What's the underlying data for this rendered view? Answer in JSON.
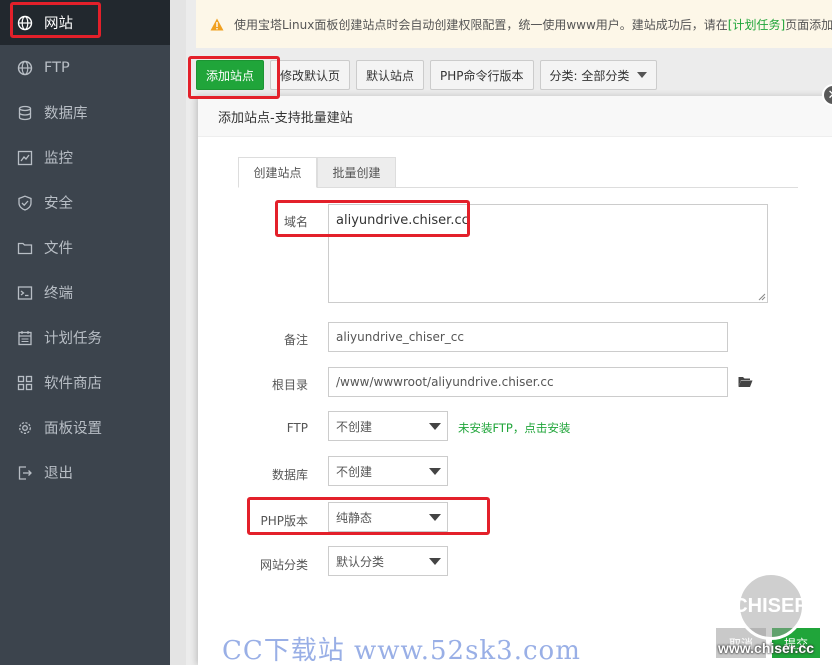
{
  "sidebar": {
    "items": [
      {
        "label": "网站",
        "icon": "globe-icon",
        "active": true
      },
      {
        "label": "FTP",
        "icon": "ftp-globe-icon"
      },
      {
        "label": "数据库",
        "icon": "database-icon"
      },
      {
        "label": "监控",
        "icon": "monitor-chart-icon"
      },
      {
        "label": "安全",
        "icon": "shield-icon"
      },
      {
        "label": "文件",
        "icon": "folder-icon"
      },
      {
        "label": "终端",
        "icon": "terminal-icon"
      },
      {
        "label": "计划任务",
        "icon": "calendar-icon"
      },
      {
        "label": "软件商店",
        "icon": "apps-grid-icon"
      },
      {
        "label": "面板设置",
        "icon": "gear-icon"
      },
      {
        "label": "退出",
        "icon": "logout-icon"
      }
    ]
  },
  "notice": {
    "text_before": "使用宝塔Linux面板创建站点时会自动创建权限配置，统一使用www用户。建站成功后，请在",
    "link": "[计划任务]",
    "text_after": "页面添加"
  },
  "toolbar": {
    "add_site": "添加站点",
    "edit_default": "修改默认页",
    "default_site": "默认站点",
    "php_cli": "PHP命令行版本",
    "category": "分类: 全部分类"
  },
  "dialog": {
    "title": "添加站点-支持批量建站",
    "tabs": [
      "创建站点",
      "批量创建"
    ],
    "domain_label": "域名",
    "domain_value": "aliyundrive.chiser.cc",
    "remark_label": "备注",
    "remark_value": "aliyundrive_chiser_cc",
    "rootdir_label": "根目录",
    "rootdir_value": "/www/wwwroot/aliyundrive.chiser.cc",
    "ftp_label": "FTP",
    "ftp_value": "不创建",
    "ftp_hint": "未安装FTP，点击安装",
    "db_label": "数据库",
    "db_value": "不创建",
    "php_label": "PHP版本",
    "php_value": "纯静态",
    "category_label": "网站分类",
    "category_value": "默认分类",
    "cancel": "取消",
    "submit": "提交"
  },
  "watermark": {
    "text": "CC下载站 www.52sk3.com",
    "logo": "CHISER",
    "logo_url": "www.chiser.cc"
  },
  "colors": {
    "accent_green": "#20a53a",
    "highlight_red": "#e3202a",
    "sidebar_bg": "#3c444d"
  }
}
